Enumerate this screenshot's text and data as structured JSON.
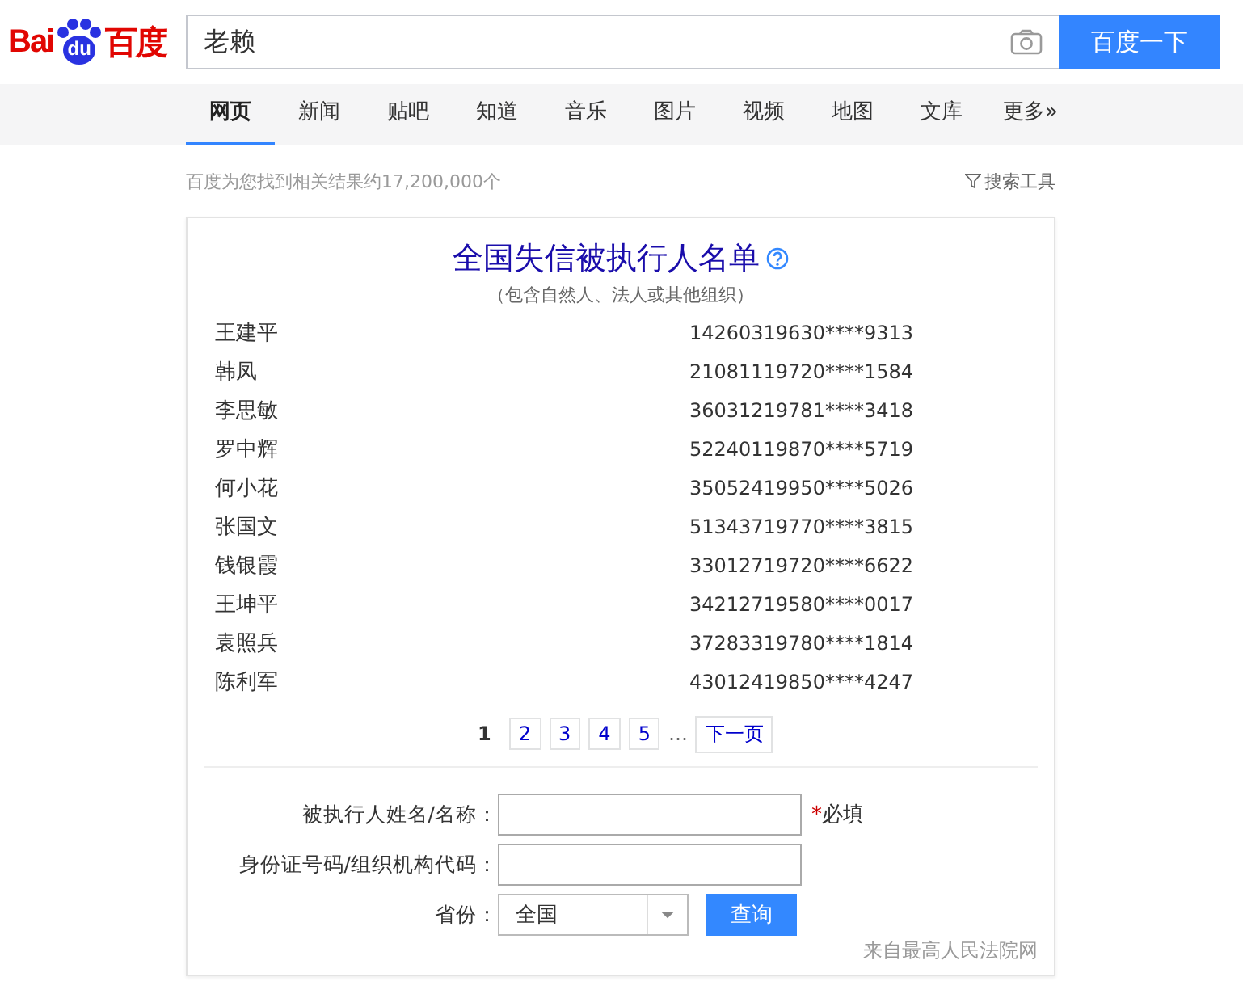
{
  "logo": {
    "left": "Bai",
    "paw": "du",
    "right": "百度"
  },
  "search": {
    "value": "老赖",
    "button": "百度一下"
  },
  "tabs": [
    {
      "label": "网页",
      "selected": true
    },
    {
      "label": "新闻",
      "selected": false
    },
    {
      "label": "贴吧",
      "selected": false
    },
    {
      "label": "知道",
      "selected": false
    },
    {
      "label": "音乐",
      "selected": false
    },
    {
      "label": "图片",
      "selected": false
    },
    {
      "label": "视频",
      "selected": false
    },
    {
      "label": "地图",
      "selected": false
    },
    {
      "label": "文库",
      "selected": false
    },
    {
      "label": "更多»",
      "selected": false
    }
  ],
  "result_count": "百度为您找到相关结果约17,200,000个",
  "search_tools": "搜索工具",
  "card": {
    "title": "全国失信被执行人名单",
    "subtitle": "（包含自然人、法人或其他组织）",
    "rows": [
      {
        "name": "王建平",
        "id": "14260319630****9313"
      },
      {
        "name": "韩凤",
        "id": "21081119720****1584"
      },
      {
        "name": "李思敏",
        "id": "36031219781****3418"
      },
      {
        "name": "罗中辉",
        "id": "52240119870****5719"
      },
      {
        "name": "何小花",
        "id": "35052419950****5026"
      },
      {
        "name": "张国文",
        "id": "51343719770****3815"
      },
      {
        "name": "钱银霞",
        "id": "33012719720****6622"
      },
      {
        "name": "王坤平",
        "id": "34212719580****0017"
      },
      {
        "name": "袁照兵",
        "id": "37283319780****1814"
      },
      {
        "name": "陈利军",
        "id": "43012419850****4247"
      }
    ],
    "pages": [
      {
        "label": "1",
        "selected": true
      },
      {
        "label": "2",
        "selected": false
      },
      {
        "label": "3",
        "selected": false
      },
      {
        "label": "4",
        "selected": false
      },
      {
        "label": "5",
        "selected": false
      }
    ],
    "ellipsis": "…",
    "next_page": "下一页",
    "form": {
      "name_label": "被执行人姓名/名称：",
      "required_mark": "*",
      "required_label": "必填",
      "id_label": "身份证号码/组织机构代码：",
      "province_label": "省份：",
      "province_value": "全国",
      "submit": "查询"
    },
    "source": "来自最高人民法院网"
  }
}
